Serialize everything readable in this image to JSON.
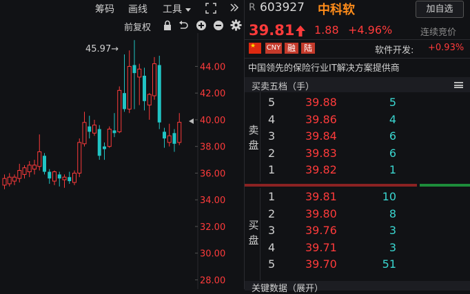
{
  "toolbar": {
    "chips": "筹码",
    "line": "画线",
    "tools": "工具",
    "restore": "前复权"
  },
  "chart_data": {
    "type": "candlestick",
    "y_ticks": [
      "44.00",
      "42.00",
      "40.00",
      "38.00",
      "36.00",
      "34.00",
      "32.00",
      "30.00",
      "28.00"
    ],
    "ylim": [
      27.3,
      46.5
    ],
    "high_label": "45.97→",
    "candles": [
      {
        "o": 35.1,
        "c": 35.6,
        "h": 35.9,
        "l": 34.8,
        "up": true
      },
      {
        "o": 35.2,
        "c": 35.7,
        "h": 36.0,
        "l": 35.0,
        "up": true
      },
      {
        "o": 35.4,
        "c": 35.7,
        "h": 35.9,
        "l": 35.1,
        "up": true
      },
      {
        "o": 35.6,
        "c": 36.2,
        "h": 36.7,
        "l": 35.3,
        "up": true
      },
      {
        "o": 35.9,
        "c": 36.4,
        "h": 36.6,
        "l": 35.6,
        "up": true
      },
      {
        "o": 36.1,
        "c": 36.6,
        "h": 36.9,
        "l": 35.7,
        "up": true
      },
      {
        "o": 36.3,
        "c": 36.6,
        "h": 37.0,
        "l": 35.9,
        "up": true
      },
      {
        "o": 36.5,
        "c": 37.6,
        "h": 38.9,
        "l": 36.2,
        "up": true
      },
      {
        "o": 37.3,
        "c": 36.1,
        "h": 37.5,
        "l": 35.9,
        "up": false
      },
      {
        "o": 36.1,
        "c": 35.6,
        "h": 36.3,
        "l": 35.2,
        "up": false
      },
      {
        "o": 35.4,
        "c": 36.1,
        "h": 36.2,
        "l": 35.1,
        "up": true
      },
      {
        "o": 35.9,
        "c": 35.6,
        "h": 36.1,
        "l": 35.0,
        "up": false
      },
      {
        "o": 35.5,
        "c": 35.7,
        "h": 35.9,
        "l": 34.9,
        "up": true
      },
      {
        "o": 35.7,
        "c": 35.4,
        "h": 36.1,
        "l": 35.2,
        "up": false
      },
      {
        "o": 35.3,
        "c": 36.0,
        "h": 36.2,
        "l": 35.1,
        "up": true
      },
      {
        "o": 36.0,
        "c": 38.3,
        "h": 38.6,
        "l": 35.7,
        "up": true
      },
      {
        "o": 38.2,
        "c": 39.8,
        "h": 40.6,
        "l": 38.0,
        "up": true
      },
      {
        "o": 39.5,
        "c": 39.1,
        "h": 40.3,
        "l": 38.6,
        "up": false
      },
      {
        "o": 39.0,
        "c": 39.6,
        "h": 40.0,
        "l": 38.8,
        "up": true
      },
      {
        "o": 39.3,
        "c": 37.3,
        "h": 39.6,
        "l": 37.0,
        "up": false
      },
      {
        "o": 37.8,
        "c": 38.0,
        "h": 38.3,
        "l": 37.0,
        "up": false
      },
      {
        "o": 38.0,
        "c": 39.3,
        "h": 39.5,
        "l": 37.9,
        "up": true
      },
      {
        "o": 39.2,
        "c": 39.0,
        "h": 40.5,
        "l": 38.7,
        "up": false
      },
      {
        "o": 39.1,
        "c": 42.2,
        "h": 42.5,
        "l": 39.0,
        "up": true
      },
      {
        "o": 42.0,
        "c": 40.8,
        "h": 44.9,
        "l": 40.6,
        "up": false
      },
      {
        "o": 40.8,
        "c": 44.0,
        "h": 45.2,
        "l": 40.5,
        "up": true
      },
      {
        "o": 44.1,
        "c": 43.5,
        "h": 45.97,
        "l": 40.8,
        "up": false
      },
      {
        "o": 43.2,
        "c": 43.8,
        "h": 44.2,
        "l": 41.1,
        "up": true
      },
      {
        "o": 43.3,
        "c": 41.4,
        "h": 43.9,
        "l": 40.7,
        "up": false
      },
      {
        "o": 41.1,
        "c": 41.9,
        "h": 42.0,
        "l": 40.0,
        "up": true
      },
      {
        "o": 41.8,
        "c": 44.2,
        "h": 44.7,
        "l": 41.5,
        "up": true
      },
      {
        "o": 44.1,
        "c": 39.8,
        "h": 44.8,
        "l": 39.3,
        "up": false
      },
      {
        "o": 39.1,
        "c": 38.6,
        "h": 39.4,
        "l": 37.9,
        "up": false
      },
      {
        "o": 38.3,
        "c": 38.8,
        "h": 39.7,
        "l": 38.0,
        "up": true
      },
      {
        "o": 39.0,
        "c": 38.2,
        "h": 39.3,
        "l": 37.6,
        "up": false
      },
      {
        "o": 38.3,
        "c": 39.81,
        "h": 40.5,
        "l": 38.1,
        "up": true
      }
    ]
  },
  "stock": {
    "prefix": "R",
    "code": "603927",
    "name": "中科软",
    "add_label": "加自选",
    "price": "39.81",
    "change": "1.88",
    "change_pct": "+4.96%",
    "status": "连续竞价",
    "tags": [
      "CNY",
      "融",
      "陆"
    ],
    "sector_label": "软件开发:",
    "sector_value": "+0.93%",
    "description": "中国领先的保险行业IT解决方案提供商"
  },
  "orderbook": {
    "title": "买卖五档（手）",
    "sell_label": [
      "卖",
      "盘"
    ],
    "buy_label": [
      "买",
      "盘"
    ],
    "sell": [
      {
        "level": "5",
        "price": "39.88",
        "vol": "5"
      },
      {
        "level": "4",
        "price": "39.86",
        "vol": "4"
      },
      {
        "level": "3",
        "price": "39.84",
        "vol": "6"
      },
      {
        "level": "2",
        "price": "39.83",
        "vol": "6"
      },
      {
        "level": "1",
        "price": "39.82",
        "vol": "1"
      }
    ],
    "buy": [
      {
        "level": "1",
        "price": "39.81",
        "vol": "10"
      },
      {
        "level": "2",
        "price": "39.80",
        "vol": "8"
      },
      {
        "level": "3",
        "price": "39.76",
        "vol": "3"
      },
      {
        "level": "4",
        "price": "39.71",
        "vol": "3"
      },
      {
        "level": "5",
        "price": "39.70",
        "vol": "51"
      }
    ]
  },
  "key_data": {
    "title": "关键数据（展开）"
  },
  "colors": {
    "up": "#ff3b3b",
    "down": "#20c4c4",
    "accent": "#ff8c1a",
    "volume": "#3ad6d0"
  }
}
